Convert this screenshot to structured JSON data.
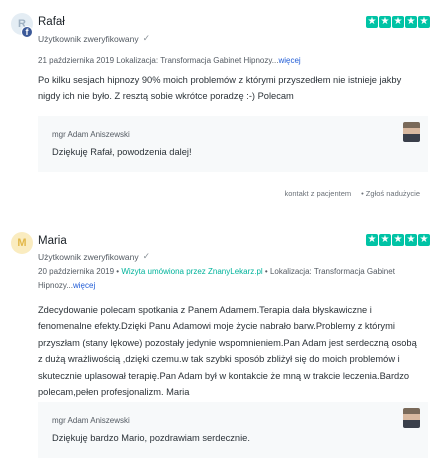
{
  "reviews": [
    {
      "initial": "R",
      "name": "Rafał",
      "verified_label": "Użytkownik zweryfikowany",
      "date": "21 października 2019",
      "location_label": "Lokalizacja:",
      "location": "Transformacja Gabinet Hipnozy...",
      "more_link": "więcej",
      "text": "Po kilku sesjach hipnozy 90% moich problemów z którymi przyszedłem nie istnieje jakby nigdy ich nie było. Z resztą sobie wkrótce poradzę :-) Polecam",
      "reply_author": "mgr Adam Aniszewski",
      "reply_text": "Dziękuję Rafał, powodzenia dalej!",
      "contact_link": "kontakt z pacjentem",
      "report_link": "Zgłoś nadużycie"
    },
    {
      "initial": "M",
      "name": "Maria",
      "verified_label": "Użytkownik zweryfikowany",
      "date": "20 października 2019",
      "visit_label": "Wizyta umówiona przez ZnanyLekarz.pl",
      "location_label": "Lokalizacja:",
      "location": "Transformacja Gabinet Hipnozy...",
      "more_link": "więcej",
      "text": "Zdecydowanie polecam spotkania z Panem Adamem.Terapia dała błyskawiczne i fenomenalne efekty.Dzięki Panu Adamowi moje życie nabrało barw.Problemy z którymi przyszłam (stany lękowe) pozostały jedynie wspomnieniem.Pan Adam jest serdeczną osobą z dużą wrażliwością ,dzięki czemu.w tak szybki sposób zbliżył się do moich problemów i skutecznie uplasował terapię.Pan Adam był w kontakcie że mną w trakcie leczenia.Bardzo polecam,pełen profesjonalizm. Maria",
      "reply_author": "mgr Adam Aniszewski",
      "reply_text": "Dziękuję bardzo Mario, pozdrawiam serdecznie."
    }
  ],
  "rating_stars": 5,
  "colors": {
    "star": "#00c3a5",
    "link": "#1f5bd6",
    "facebook": "#3b5998"
  },
  "icons": {
    "verified": "check-icon",
    "facebook": "facebook-badge-icon",
    "report": "flag-icon"
  }
}
